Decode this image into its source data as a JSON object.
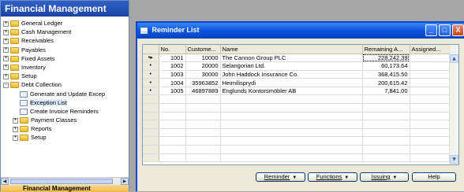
{
  "nav": {
    "title": "Financial Management",
    "footer_label": "Financial Management",
    "items": [
      {
        "label": "General Ledger",
        "expander": "+",
        "type": "folder",
        "indent": 0
      },
      {
        "label": "Cash Management",
        "expander": "+",
        "type": "folder",
        "indent": 0
      },
      {
        "label": "Receivables",
        "expander": "+",
        "type": "folder",
        "indent": 0
      },
      {
        "label": "Payables",
        "expander": "+",
        "type": "folder",
        "indent": 0
      },
      {
        "label": "Fixed Assets",
        "expander": "+",
        "type": "folder",
        "indent": 0
      },
      {
        "label": "Inventory",
        "expander": "+",
        "type": "folder",
        "indent": 0
      },
      {
        "label": "Setup",
        "expander": "+",
        "type": "folder",
        "indent": 0
      },
      {
        "label": "Debt Collection",
        "expander": "-",
        "type": "folder-open",
        "indent": 0
      },
      {
        "label": "Generate and Update Excep",
        "expander": "",
        "type": "doc",
        "indent": 1
      },
      {
        "label": "Exception List",
        "expander": "",
        "type": "doc",
        "indent": 1,
        "selected": true
      },
      {
        "label": "Create Invoice Reminders",
        "expander": "",
        "type": "doc",
        "indent": 1
      },
      {
        "label": "Payment Classes",
        "expander": "+",
        "type": "folder",
        "indent": 1
      },
      {
        "label": "Reports",
        "expander": "+",
        "type": "folder",
        "indent": 1
      },
      {
        "label": "Setup",
        "expander": "+",
        "type": "folder",
        "indent": 1
      }
    ]
  },
  "window": {
    "title": "Reminder List",
    "controls": {
      "minimize": "_",
      "maximize": "□",
      "close": "X"
    }
  },
  "grid": {
    "columns": [
      "No.",
      "Custome...",
      "Name",
      "Remaining A...",
      "Assigned..."
    ],
    "rows": [
      {
        "marker": "•▸",
        "no": "1001",
        "customer": "10000",
        "name": "The Cannon Group PLC",
        "remaining": "228,242.39",
        "assigned": ""
      },
      {
        "marker": "•",
        "no": "1002",
        "customer": "20000",
        "name": "Selangorian Ltd.",
        "remaining": "60,173.64",
        "assigned": ""
      },
      {
        "marker": "•",
        "no": "1003",
        "customer": "30000",
        "name": "John Haddock Insurance Co.",
        "remaining": "368,415.50",
        "assigned": ""
      },
      {
        "marker": "•",
        "no": "1004",
        "customer": "35963852",
        "name": "Heimilisprydi",
        "remaining": "200,615.42",
        "assigned": ""
      },
      {
        "marker": "•",
        "no": "1005",
        "customer": "46897889",
        "name": "Englunds Kontorsmöbler AB",
        "remaining": "7,841.00",
        "assigned": ""
      }
    ],
    "empty_rows": 8
  },
  "buttons": {
    "reminder": "Reminder",
    "functions": "Functions",
    "issuing": "Issuing",
    "help": "Help",
    "dropdown_glyph": "▼"
  },
  "scroll": {
    "up": "▲",
    "down": "▼",
    "left": "◀",
    "right": "▶"
  }
}
